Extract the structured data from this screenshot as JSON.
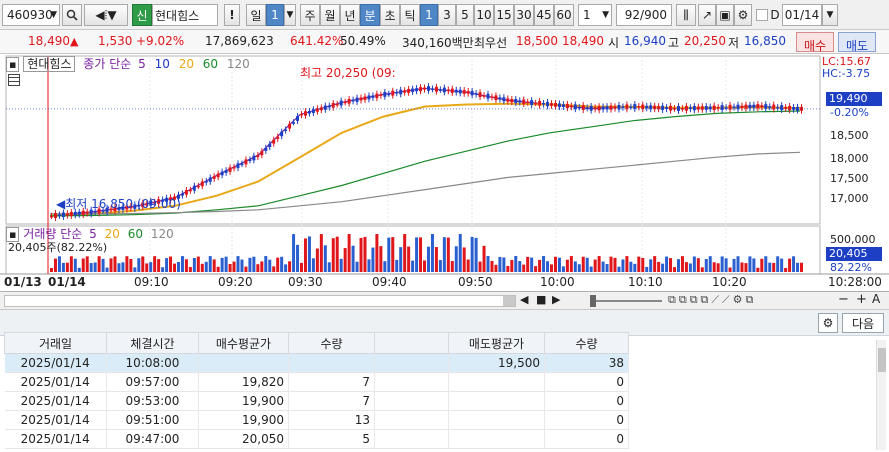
{
  "toolbar": {
    "stock_code": "460930",
    "stock_tag": "신",
    "stock_name": "현대힘스",
    "bang": "!",
    "period_options": [
      "일",
      "1",
      "주",
      "월",
      "년",
      "분",
      "초",
      "틱"
    ],
    "minute_options": [
      "1",
      "3",
      "5",
      "10",
      "15",
      "30",
      "45",
      "60"
    ],
    "interval_value": "1",
    "page_counter": "92/900",
    "date_checkbox_label": "D",
    "date_value": "01/14"
  },
  "quote": {
    "price": "18,490",
    "change_arrow": "▲",
    "change": "1,530",
    "change_pct": "+9.02%",
    "volume": "17,869,623",
    "volume_ratio": "641.42%",
    "strength": "50.49%",
    "amount": "340,160백만",
    "priority_label": "최우선",
    "ask": "18,500",
    "bid": "18,490",
    "open_label": "시",
    "open": "16,940",
    "high_label": "고",
    "high": "20,250",
    "low_label": "저",
    "low": "16,850",
    "buy_button": "매수",
    "sell_button": "매도"
  },
  "chart": {
    "main_title": "현대힘스",
    "main_legend_prefix": "종가 단순",
    "ma_labels": [
      "5",
      "10",
      "20",
      "60",
      "120"
    ],
    "ma_colors": [
      "#7a1fa2",
      "#1b36c9",
      "#e8a817",
      "#1a8a2a",
      "#888888"
    ],
    "high_annotation": "최고 20,250 (09:",
    "low_annotation": "최저 16,850 (09:00)",
    "lc_label": "LC:15.67",
    "hc_label": "HC:-3.75",
    "price_tag": "19,490",
    "pct_tag": "-0.20%",
    "y_labels": [
      "18,500",
      "18,000",
      "17,500",
      "17,000"
    ],
    "volume_title": "거래량 단순",
    "volume_ma_labels": [
      "5",
      "20",
      "60",
      "120"
    ],
    "volume_info": "20,405주(82.22%)",
    "vol_axis_label": "500,000",
    "vol_tag": "20,405",
    "vol_pct_tag": "82.22%",
    "x_labels": [
      "01/13",
      "01/14",
      "09:10",
      "09:20",
      "09:30",
      "09:40",
      "09:50",
      "10:00",
      "10:10",
      "10:20",
      "10:28:00"
    ]
  },
  "chart_data": {
    "type": "line",
    "title": "현대힘스",
    "ylim": [
      16700,
      20500
    ],
    "x": [
      "09:00",
      "09:05",
      "09:10",
      "09:15",
      "09:20",
      "09:25",
      "09:30",
      "09:35",
      "09:40",
      "09:45",
      "09:50",
      "09:55",
      "10:00",
      "10:05",
      "10:10",
      "10:15",
      "10:20",
      "10:25",
      "10:28"
    ],
    "series": [
      {
        "name": "5",
        "values": [
          16850,
          16950,
          17080,
          17300,
          17850,
          18350,
          19350,
          19650,
          19850,
          20000,
          19900,
          19700,
          19600,
          19500,
          19550,
          19500,
          19520,
          19560,
          19490
        ]
      },
      {
        "name": "20",
        "values": [
          16850,
          16900,
          16980,
          17100,
          17350,
          17700,
          18300,
          18900,
          19300,
          19550,
          19600,
          19620,
          19600,
          19550,
          19540,
          19520,
          19520,
          19530,
          19510
        ]
      },
      {
        "name": "60",
        "values": [
          16850,
          16860,
          16880,
          16920,
          17000,
          17100,
          17350,
          17600,
          17900,
          18200,
          18450,
          18700,
          18900,
          19050,
          19200,
          19300,
          19380,
          19420,
          19440
        ]
      },
      {
        "name": "120",
        "values": [
          16900,
          16900,
          16910,
          16930,
          16960,
          17000,
          17100,
          17200,
          17350,
          17500,
          17650,
          17800,
          17900,
          18000,
          18100,
          18200,
          18300,
          18380,
          18420
        ]
      }
    ]
  },
  "control": {
    "buttons": [
      "◀",
      "■",
      "▶",
      "−",
      "+",
      "A"
    ]
  },
  "lower": {
    "next_button": "다음",
    "columns": [
      "거래일",
      "체결시간",
      "매수평균가",
      "수량",
      "",
      "매도평균가",
      "수량"
    ],
    "rows": [
      {
        "date": "2025/01/14",
        "time": "10:08:00",
        "buy_avg": "",
        "buy_qty": "",
        "blank": "",
        "sell_avg": "19,500",
        "sell_qty": "38"
      },
      {
        "date": "2025/01/14",
        "time": "09:57:00",
        "buy_avg": "19,820",
        "buy_qty": "7",
        "blank": "",
        "sell_avg": "",
        "sell_qty": "0"
      },
      {
        "date": "2025/01/14",
        "time": "09:53:00",
        "buy_avg": "19,900",
        "buy_qty": "7",
        "blank": "",
        "sell_avg": "",
        "sell_qty": "0"
      },
      {
        "date": "2025/01/14",
        "time": "09:51:00",
        "buy_avg": "19,900",
        "buy_qty": "13",
        "blank": "",
        "sell_avg": "",
        "sell_qty": "0"
      },
      {
        "date": "2025/01/14",
        "time": "09:47:00",
        "buy_avg": "20,050",
        "buy_qty": "5",
        "blank": "",
        "sell_avg": "",
        "sell_qty": "0"
      }
    ]
  }
}
